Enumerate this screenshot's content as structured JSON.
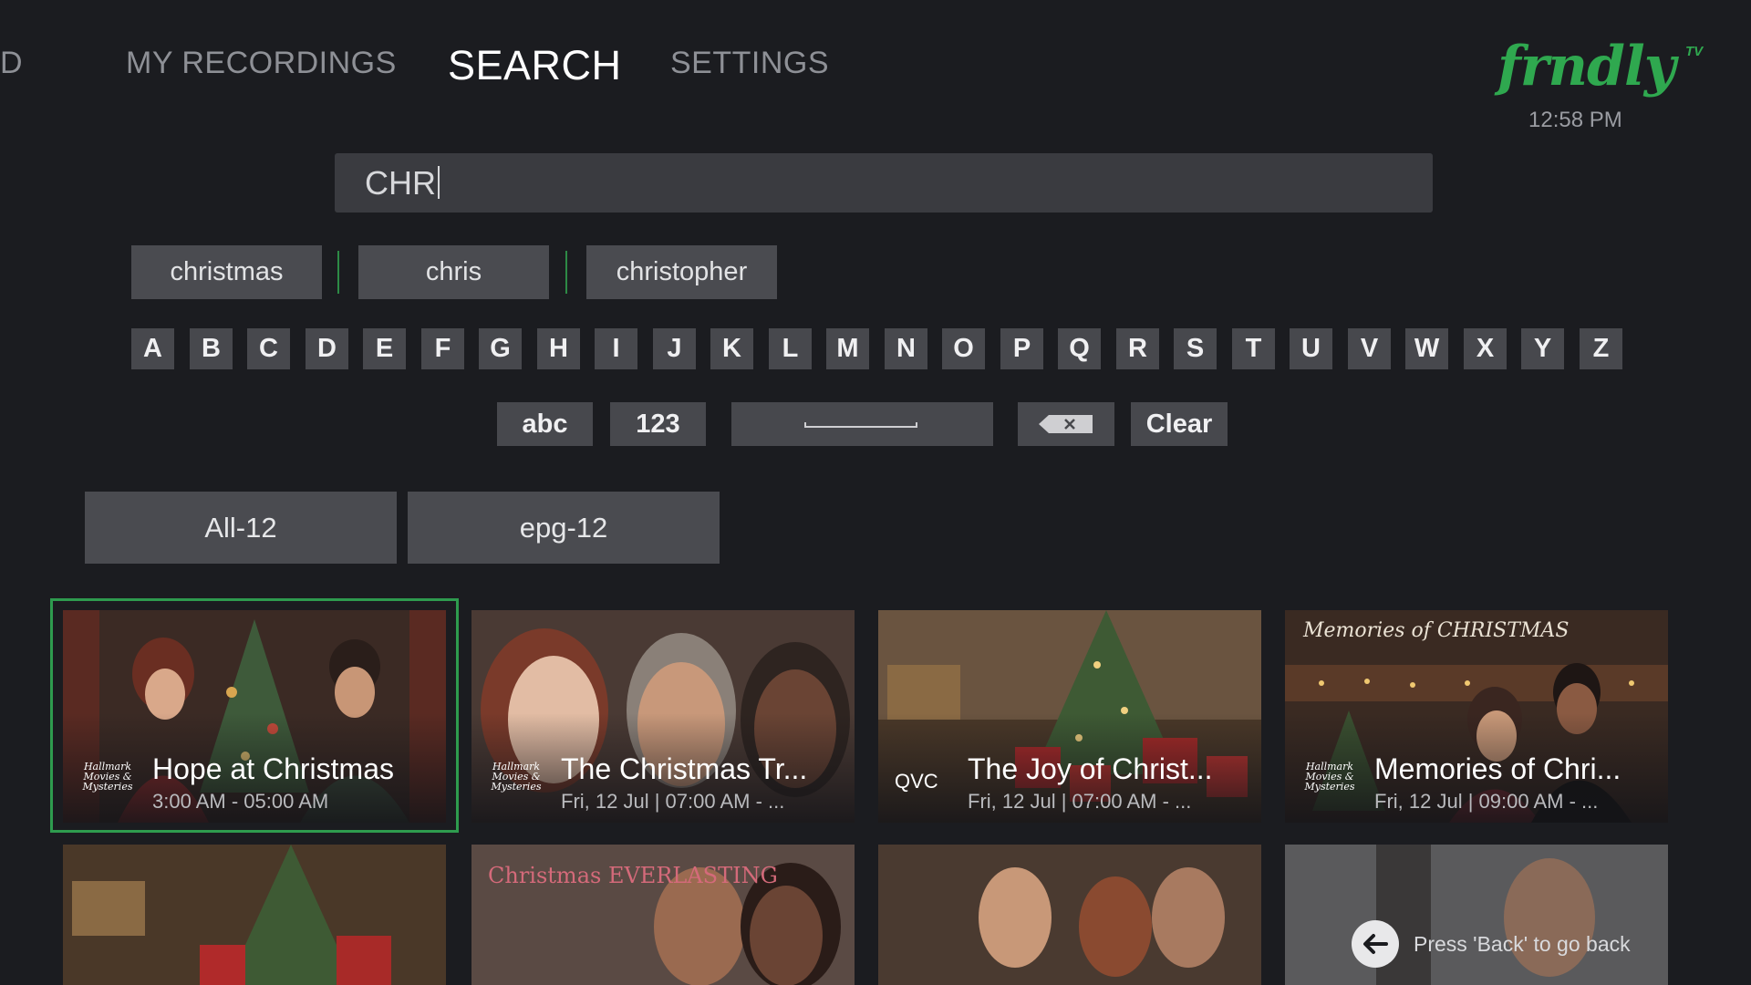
{
  "nav": {
    "items": [
      {
        "label": "D",
        "active": false
      },
      {
        "label": "MY RECORDINGS",
        "active": false
      },
      {
        "label": "SEARCH",
        "active": true
      },
      {
        "label": "SETTINGS",
        "active": false
      }
    ]
  },
  "brand": {
    "name": "frndly",
    "suffix": "TV",
    "color": "#2fa84f"
  },
  "clock": "12:58 PM",
  "search": {
    "value": "CHR"
  },
  "suggestions": [
    "christmas",
    "chris",
    "christopher"
  ],
  "keyboard": {
    "letters": [
      "A",
      "B",
      "C",
      "D",
      "E",
      "F",
      "G",
      "H",
      "I",
      "J",
      "K",
      "L",
      "M",
      "N",
      "O",
      "P",
      "Q",
      "R",
      "S",
      "T",
      "U",
      "V",
      "W",
      "X",
      "Y",
      "Z"
    ],
    "abc_label": "abc",
    "num_label": "123",
    "clear_label": "Clear"
  },
  "filters": [
    {
      "label": "All-12",
      "selected": true
    },
    {
      "label": "epg-12",
      "selected": false
    }
  ],
  "results": [
    {
      "title": "Hope at Christmas",
      "time": "3:00 AM - 05:00 AM",
      "channel": "Hallmark Movies & Mysteries",
      "selected": true
    },
    {
      "title": "The Christmas Tr...",
      "time": "Fri, 12 Jul | 07:00 AM - ...",
      "channel": "Hallmark Movies & Mysteries",
      "selected": false
    },
    {
      "title": "The Joy of Christ...",
      "time": "Fri, 12 Jul | 07:00 AM - ...",
      "channel": "QVC",
      "selected": false
    },
    {
      "title": "Memories of Chri...",
      "time": "Fri, 12 Jul | 09:00 AM - ...",
      "channel": "Hallmark Movies & Mysteries",
      "banner": "Memories of CHRISTMAS",
      "selected": false
    }
  ],
  "results_row2": [
    {
      "banner": ""
    },
    {
      "banner": "Christmas EVERLASTING"
    },
    {
      "banner": ""
    },
    {
      "banner": ""
    }
  ],
  "back_hint": "Press 'Back' to go back"
}
